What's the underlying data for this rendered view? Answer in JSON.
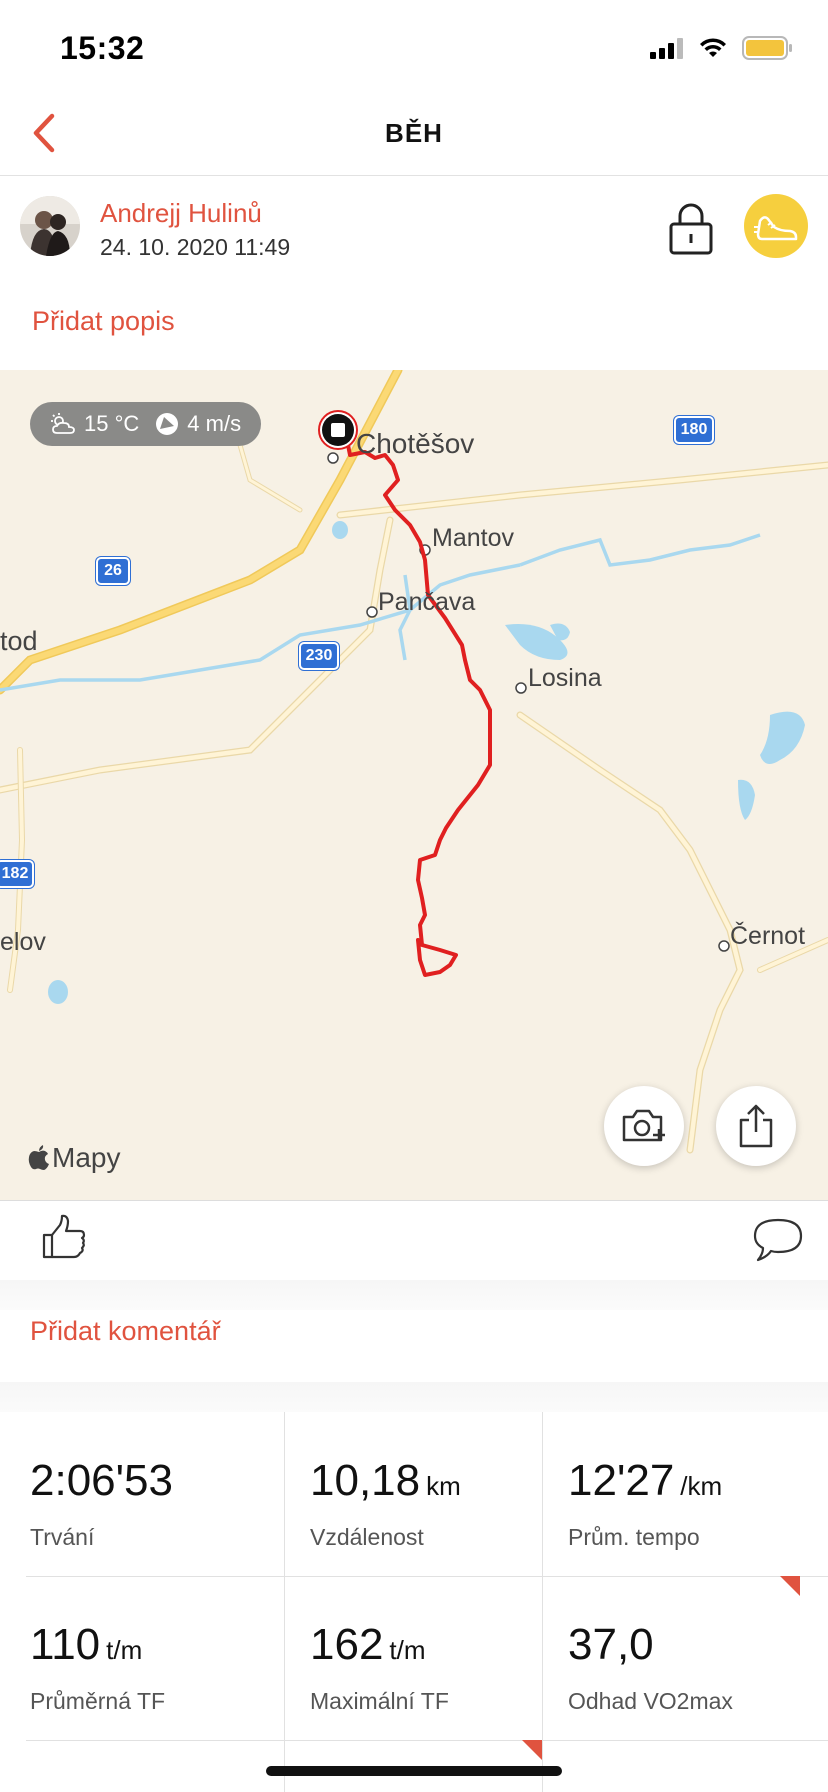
{
  "status_bar": {
    "time": "15:32",
    "icons": [
      "signal-icon",
      "wifi-icon",
      "battery-icon"
    ]
  },
  "nav": {
    "title": "BĚH",
    "back_icon": "chevron-left-icon"
  },
  "user": {
    "name": "Andrejj Hulinů",
    "datetime": "24. 10. 2020 11:49",
    "lock_icon": "lock-icon",
    "sport_icon": "running-shoe-icon"
  },
  "add_description": "Přidat popis",
  "map": {
    "weather": {
      "temperature": "15 °C",
      "wind": "4 m/s"
    },
    "places": [
      "Chotěšov",
      "Mantov",
      "Pančava",
      "Losina",
      "Černot",
      "tod",
      "elov"
    ],
    "road_shields": [
      "180",
      "26",
      "230",
      "182"
    ],
    "attribution": "Mapy",
    "buttons": [
      "add-photo-button",
      "share-button"
    ]
  },
  "actions": {
    "like_icon": "thumbs-up-icon",
    "comment_icon": "speech-bubble-icon"
  },
  "add_comment": "Přidat komentář",
  "stats": [
    {
      "value": "2:06'53",
      "unit": "",
      "label": "Trvání"
    },
    {
      "value": "10,18",
      "unit": "km",
      "label": "Vzdálenost"
    },
    {
      "value": "12'27",
      "unit": "/km",
      "label": "Prům. tempo"
    },
    {
      "value": "110",
      "unit": "t/m",
      "label": "Průměrná TF"
    },
    {
      "value": "162",
      "unit": "t/m",
      "label": "Maximální TF"
    },
    {
      "value": "37,0",
      "unit": "",
      "label": "Odhad VO2max"
    }
  ],
  "colors": {
    "accent": "#e0533f",
    "sport": "#f6cf3e",
    "route": "#e02020",
    "map_bg": "#f7f1e5"
  }
}
